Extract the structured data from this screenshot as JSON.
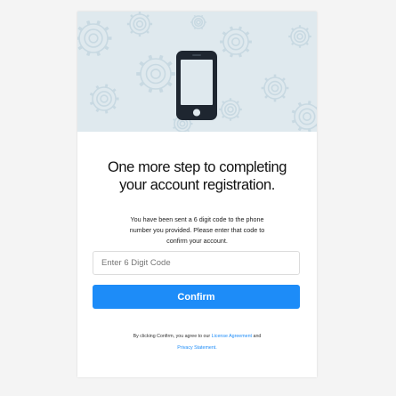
{
  "colors": {
    "accent": "#1d8cf8",
    "hero_background": "#dfe9ee",
    "gear_pattern": "#c8d9e2",
    "page_background": "#f4f4f4"
  },
  "hero": {
    "icon": "smartphone-icon",
    "decoration": "gear-pattern"
  },
  "heading": {
    "line1": "One more step to completing",
    "line2": "your account registration."
  },
  "description": {
    "line1": "You have been sent a 6 digit code to the phone",
    "line2": "number you provided. Please enter that code to",
    "line3": "confirm your account."
  },
  "code_field": {
    "placeholder": "Enter 6 Digit Code",
    "value": ""
  },
  "confirm_button": {
    "label": "Confirm"
  },
  "terms": {
    "prefix": "By clicking Confirm, you agree to our",
    "license_link": "License Agreement",
    "conjunction": "and",
    "privacy_link": "Privacy Statement."
  }
}
